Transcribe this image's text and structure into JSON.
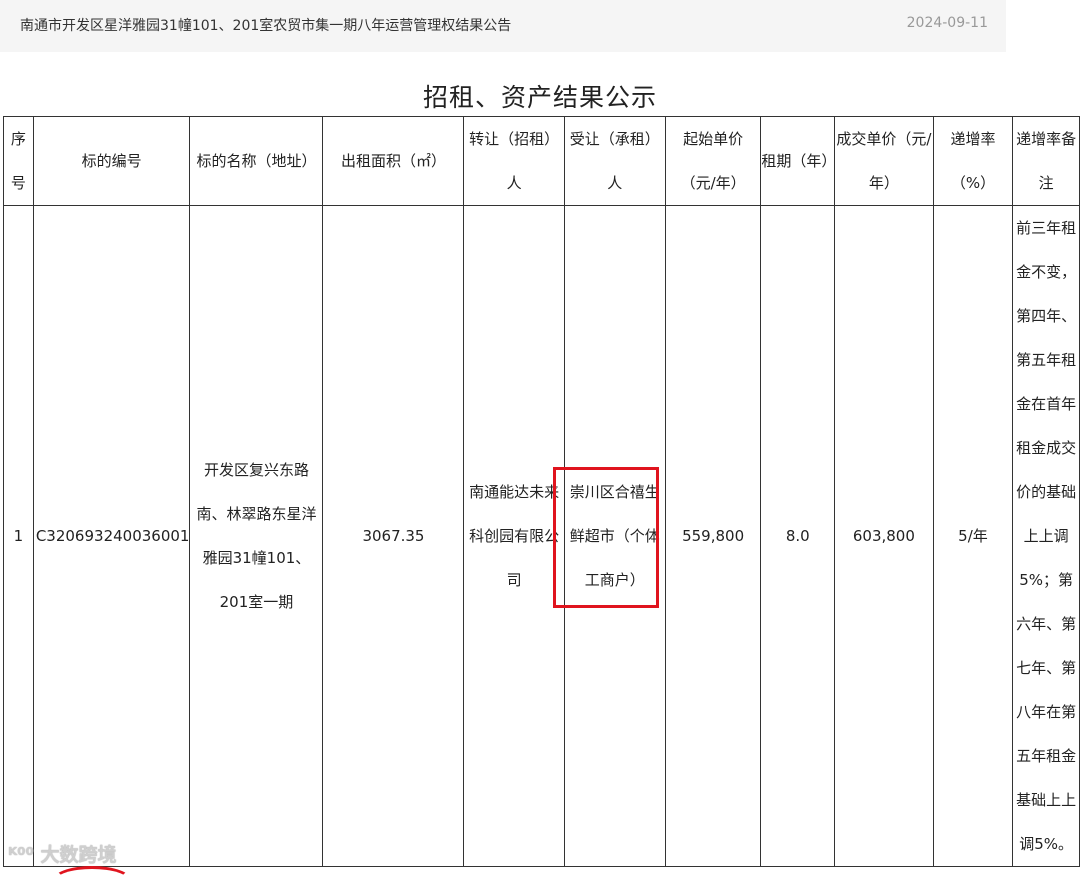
{
  "notice": {
    "title": "南通市开发区星洋雅园31幢101、201室农贸市集一期八年运营管理权结果公告",
    "date": "2024-09-11"
  },
  "page_title": "招租、资产结果公示",
  "table": {
    "headers": [
      "序号",
      "标的编号",
      "标的名称（地址）",
      "出租面积（㎡）",
      "转让（招租）人",
      "受让（承租）人",
      "起始单价（元/年）",
      "租期（年）",
      "成交单价（元/年）",
      "递增率（%）",
      "递增率备注"
    ],
    "rows": [
      {
        "index": "1",
        "code": "C320693240036001",
        "name": "开发区复兴东路南、林翠路东星洋雅园31幢101、201室一期",
        "area": "3067.35",
        "transferor": "南通能达未来科创园有限公司",
        "transferee": "崇川区合禧生鲜超市（个体工商户）",
        "start_price": "559,800",
        "term": "8.0",
        "deal_price": "603,800",
        "rate": "5/年",
        "rate_note": "前三年租金不变，第四年、第五年租金在首年租金成交价的基础上上调5%；第六年、第七年、第八年在第五年租金基础上上调5%。"
      }
    ]
  },
  "highlight_color": "#e0141e",
  "watermark": "大数跨境"
}
